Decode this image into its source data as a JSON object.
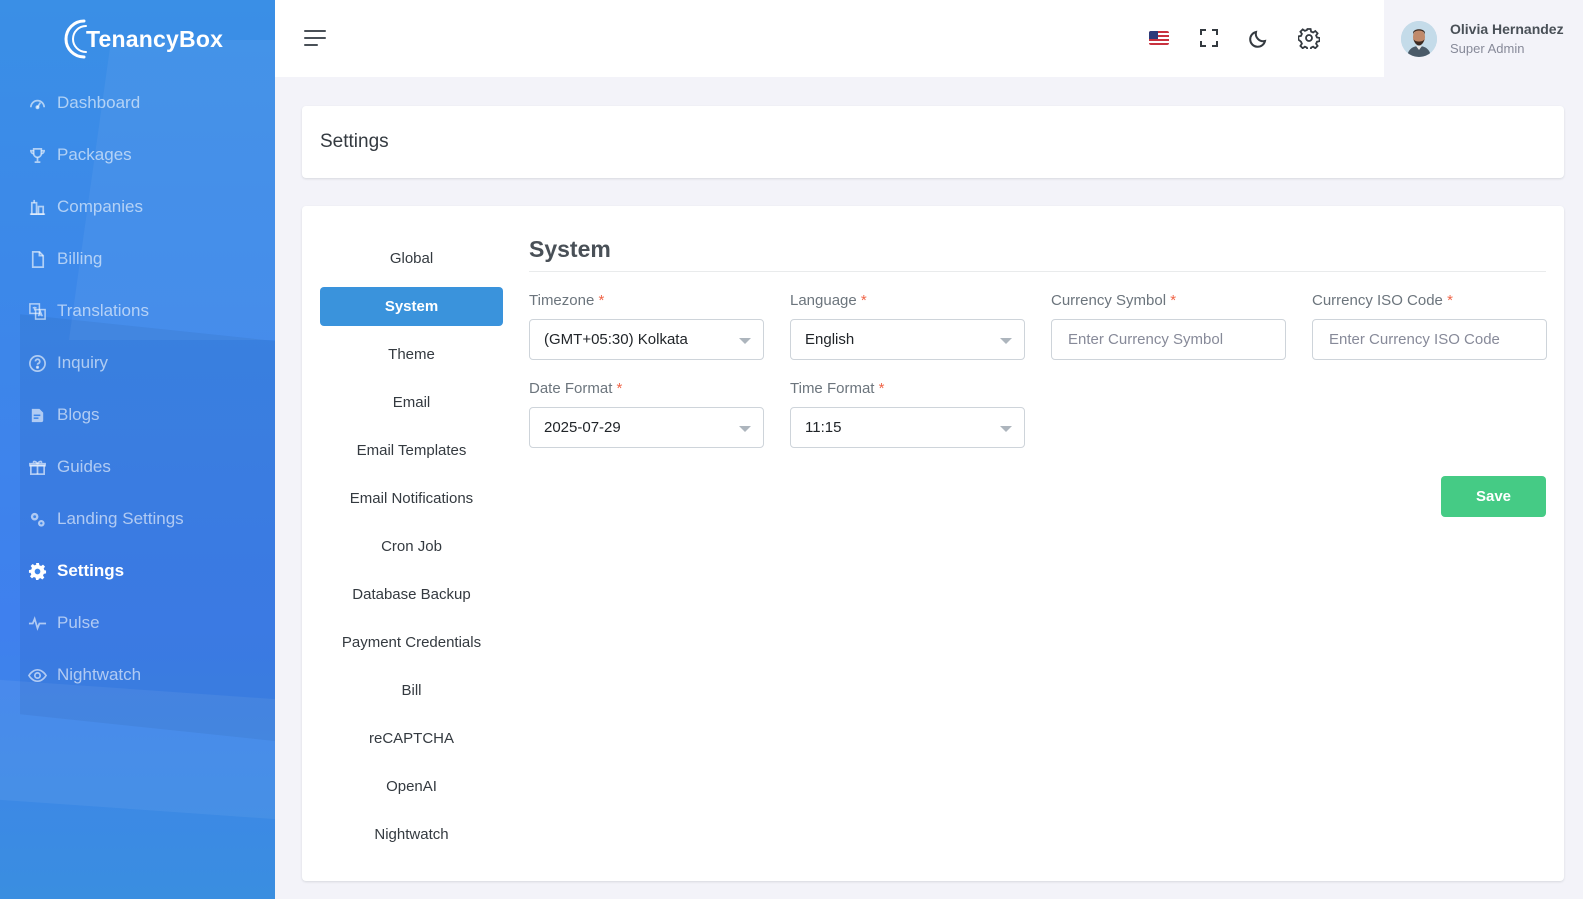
{
  "brand": {
    "name": "TenancyBox"
  },
  "sidebar": {
    "items": [
      {
        "label": "Dashboard",
        "icon": "dashboard-icon"
      },
      {
        "label": "Packages",
        "icon": "trophy-icon"
      },
      {
        "label": "Companies",
        "icon": "buildings-icon"
      },
      {
        "label": "Billing",
        "icon": "file-icon"
      },
      {
        "label": "Translations",
        "icon": "translate-icon"
      },
      {
        "label": "Inquiry",
        "icon": "question-icon"
      },
      {
        "label": "Blogs",
        "icon": "blog-icon"
      },
      {
        "label": "Guides",
        "icon": "gift-icon"
      },
      {
        "label": "Landing Settings",
        "icon": "gears-icon"
      },
      {
        "label": "Settings",
        "icon": "gear-icon",
        "active": true
      },
      {
        "label": "Pulse",
        "icon": "pulse-icon"
      },
      {
        "label": "Nightwatch",
        "icon": "eye-icon"
      }
    ]
  },
  "header": {
    "icons": [
      "menu-icon",
      "us-flag-icon",
      "fullscreen-icon",
      "moon-icon",
      "gear-icon"
    ],
    "user": {
      "name": "Olivia Hernandez",
      "role": "Super Admin"
    }
  },
  "page": {
    "title": "Settings"
  },
  "settings_menu": {
    "items": [
      "Global",
      "System",
      "Theme",
      "Email",
      "Email Templates",
      "Email Notifications",
      "Cron Job",
      "Database Backup",
      "Payment Credentials",
      "Bill",
      "reCAPTCHA",
      "OpenAI",
      "Nightwatch"
    ],
    "active": "System"
  },
  "form": {
    "title": "System",
    "timezone": {
      "label": "Timezone",
      "value": "(GMT+05:30) Kolkata"
    },
    "language": {
      "label": "Language",
      "value": "English"
    },
    "currency_symbol": {
      "label": "Currency Symbol",
      "placeholder": "Enter Currency Symbol"
    },
    "currency_iso": {
      "label": "Currency ISO Code",
      "placeholder": "Enter Currency ISO Code"
    },
    "date_format": {
      "label": "Date Format",
      "value": "2025-07-29"
    },
    "time_format": {
      "label": "Time Format",
      "value": "11:15"
    },
    "required_mark": "*",
    "save_label": "Save"
  },
  "colors": {
    "primary": "#3a93dc",
    "success": "#45cb85",
    "required": "#f06548",
    "sidebar": "#3d86ea"
  }
}
